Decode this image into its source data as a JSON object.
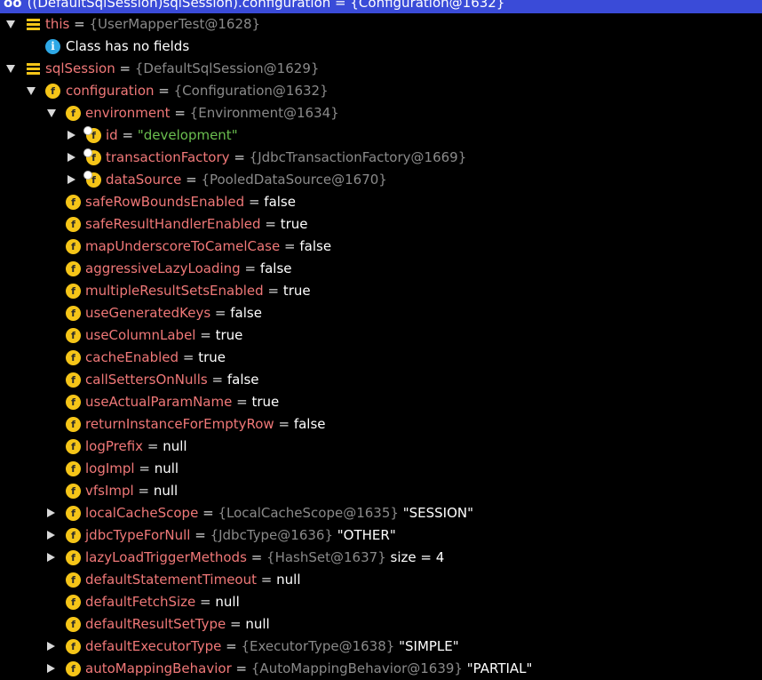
{
  "header": {
    "text": "((DefaultSqlSession)sqlSession).configuration = {Configuration@1632}",
    "badge": "oo"
  },
  "rows": [
    {
      "indent": 0,
      "expand": "open",
      "icon": "list",
      "name": "this",
      "ref": "{UserMapperTest@1628}",
      "value": "",
      "str": ""
    },
    {
      "indent": 1,
      "expand": "none",
      "icon": "info",
      "name": "",
      "plain": "Class has no fields"
    },
    {
      "indent": 0,
      "expand": "open",
      "icon": "list",
      "name": "sqlSession",
      "ref": "{DefaultSqlSession@1629}",
      "value": "",
      "str": ""
    },
    {
      "indent": 1,
      "expand": "open",
      "icon": "field",
      "name": "configuration",
      "ref": "{Configuration@1632}",
      "value": "",
      "str": ""
    },
    {
      "indent": 2,
      "expand": "open",
      "icon": "field",
      "name": "environment",
      "ref": "{Environment@1634}",
      "value": "",
      "str": ""
    },
    {
      "indent": 3,
      "expand": "closed",
      "icon": "field-final",
      "name": "id",
      "ref": "",
      "value": "",
      "str": "\"development\""
    },
    {
      "indent": 3,
      "expand": "closed",
      "icon": "field-final",
      "name": "transactionFactory",
      "ref": "{JdbcTransactionFactory@1669}",
      "value": "",
      "str": ""
    },
    {
      "indent": 3,
      "expand": "closed",
      "icon": "field-final",
      "name": "dataSource",
      "ref": "{PooledDataSource@1670}",
      "value": "",
      "str": ""
    },
    {
      "indent": 2,
      "expand": "none",
      "icon": "field",
      "name": "safeRowBoundsEnabled",
      "ref": "",
      "value": "false",
      "str": ""
    },
    {
      "indent": 2,
      "expand": "none",
      "icon": "field",
      "name": "safeResultHandlerEnabled",
      "ref": "",
      "value": "true",
      "str": ""
    },
    {
      "indent": 2,
      "expand": "none",
      "icon": "field",
      "name": "mapUnderscoreToCamelCase",
      "ref": "",
      "value": "false",
      "str": ""
    },
    {
      "indent": 2,
      "expand": "none",
      "icon": "field",
      "name": "aggressiveLazyLoading",
      "ref": "",
      "value": "false",
      "str": ""
    },
    {
      "indent": 2,
      "expand": "none",
      "icon": "field",
      "name": "multipleResultSetsEnabled",
      "ref": "",
      "value": "true",
      "str": ""
    },
    {
      "indent": 2,
      "expand": "none",
      "icon": "field",
      "name": "useGeneratedKeys",
      "ref": "",
      "value": "false",
      "str": ""
    },
    {
      "indent": 2,
      "expand": "none",
      "icon": "field",
      "name": "useColumnLabel",
      "ref": "",
      "value": "true",
      "str": ""
    },
    {
      "indent": 2,
      "expand": "none",
      "icon": "field",
      "name": "cacheEnabled",
      "ref": "",
      "value": "true",
      "str": ""
    },
    {
      "indent": 2,
      "expand": "none",
      "icon": "field",
      "name": "callSettersOnNulls",
      "ref": "",
      "value": "false",
      "str": ""
    },
    {
      "indent": 2,
      "expand": "none",
      "icon": "field",
      "name": "useActualParamName",
      "ref": "",
      "value": "true",
      "str": ""
    },
    {
      "indent": 2,
      "expand": "none",
      "icon": "field",
      "name": "returnInstanceForEmptyRow",
      "ref": "",
      "value": "false",
      "str": ""
    },
    {
      "indent": 2,
      "expand": "none",
      "icon": "field",
      "name": "logPrefix",
      "ref": "",
      "value": "null",
      "str": ""
    },
    {
      "indent": 2,
      "expand": "none",
      "icon": "field",
      "name": "logImpl",
      "ref": "",
      "value": "null",
      "str": ""
    },
    {
      "indent": 2,
      "expand": "none",
      "icon": "field",
      "name": "vfsImpl",
      "ref": "",
      "value": "null",
      "str": ""
    },
    {
      "indent": 2,
      "expand": "closed",
      "icon": "field",
      "name": "localCacheScope",
      "ref": "{LocalCacheScope@1635}",
      "value": "\"SESSION\"",
      "str": ""
    },
    {
      "indent": 2,
      "expand": "closed",
      "icon": "field",
      "name": "jdbcTypeForNull",
      "ref": "{JdbcType@1636}",
      "value": "\"OTHER\"",
      "str": ""
    },
    {
      "indent": 2,
      "expand": "closed",
      "icon": "field",
      "name": "lazyLoadTriggerMethods",
      "ref": "{HashSet@1637}",
      "value": " size = 4",
      "str": ""
    },
    {
      "indent": 2,
      "expand": "none",
      "icon": "field",
      "name": "defaultStatementTimeout",
      "ref": "",
      "value": "null",
      "str": ""
    },
    {
      "indent": 2,
      "expand": "none",
      "icon": "field",
      "name": "defaultFetchSize",
      "ref": "",
      "value": "null",
      "str": ""
    },
    {
      "indent": 2,
      "expand": "none",
      "icon": "field",
      "name": "defaultResultSetType",
      "ref": "",
      "value": "null",
      "str": ""
    },
    {
      "indent": 2,
      "expand": "closed",
      "icon": "field",
      "name": "defaultExecutorType",
      "ref": "{ExecutorType@1638}",
      "value": "\"SIMPLE\"",
      "str": ""
    },
    {
      "indent": 2,
      "expand": "closed",
      "icon": "field",
      "name": "autoMappingBehavior",
      "ref": "{AutoMappingBehavior@1639}",
      "value": "\"PARTIAL\"",
      "str": ""
    }
  ],
  "labels": {
    "equals": "=",
    "field_icon_letter": "f",
    "info_icon_letter": "i"
  },
  "colors": {
    "background": "#000000",
    "header_bg": "#3a4bd8",
    "field_name": "#f07878",
    "reference": "#8a8a8a",
    "string": "#6bbf4f",
    "icon_yellow": "#f5c518",
    "info_blue": "#2ea8e6"
  }
}
